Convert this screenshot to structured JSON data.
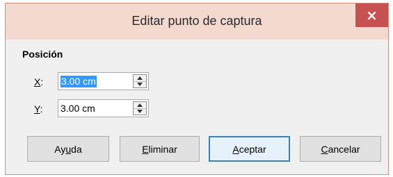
{
  "dialog": {
    "title": "Editar punto de captura",
    "close_symbol": "×",
    "section_label": "Posición",
    "x": {
      "label_mnemonic": "X",
      "label_rest": ":",
      "value": "3.00 cm"
    },
    "y": {
      "label_mnemonic": "Y",
      "label_rest": ":",
      "value": "3.00 cm"
    },
    "buttons": {
      "help_pre": "Ay",
      "help_mnemonic": "u",
      "help_post": "da",
      "delete_mnemonic": "E",
      "delete_rest": "liminar",
      "ok_mnemonic": "A",
      "ok_rest": "ceptar",
      "cancel_mnemonic": "C",
      "cancel_rest": "ancelar"
    }
  },
  "colors": {
    "titlebar": "#f3d9cf",
    "close_button": "#c75050",
    "selection": "#3399ff",
    "default_button_border": "#3c7fb1"
  },
  "icons": [
    "close-icon",
    "spin-up-arrow-icon",
    "spin-down-arrow-icon"
  ]
}
